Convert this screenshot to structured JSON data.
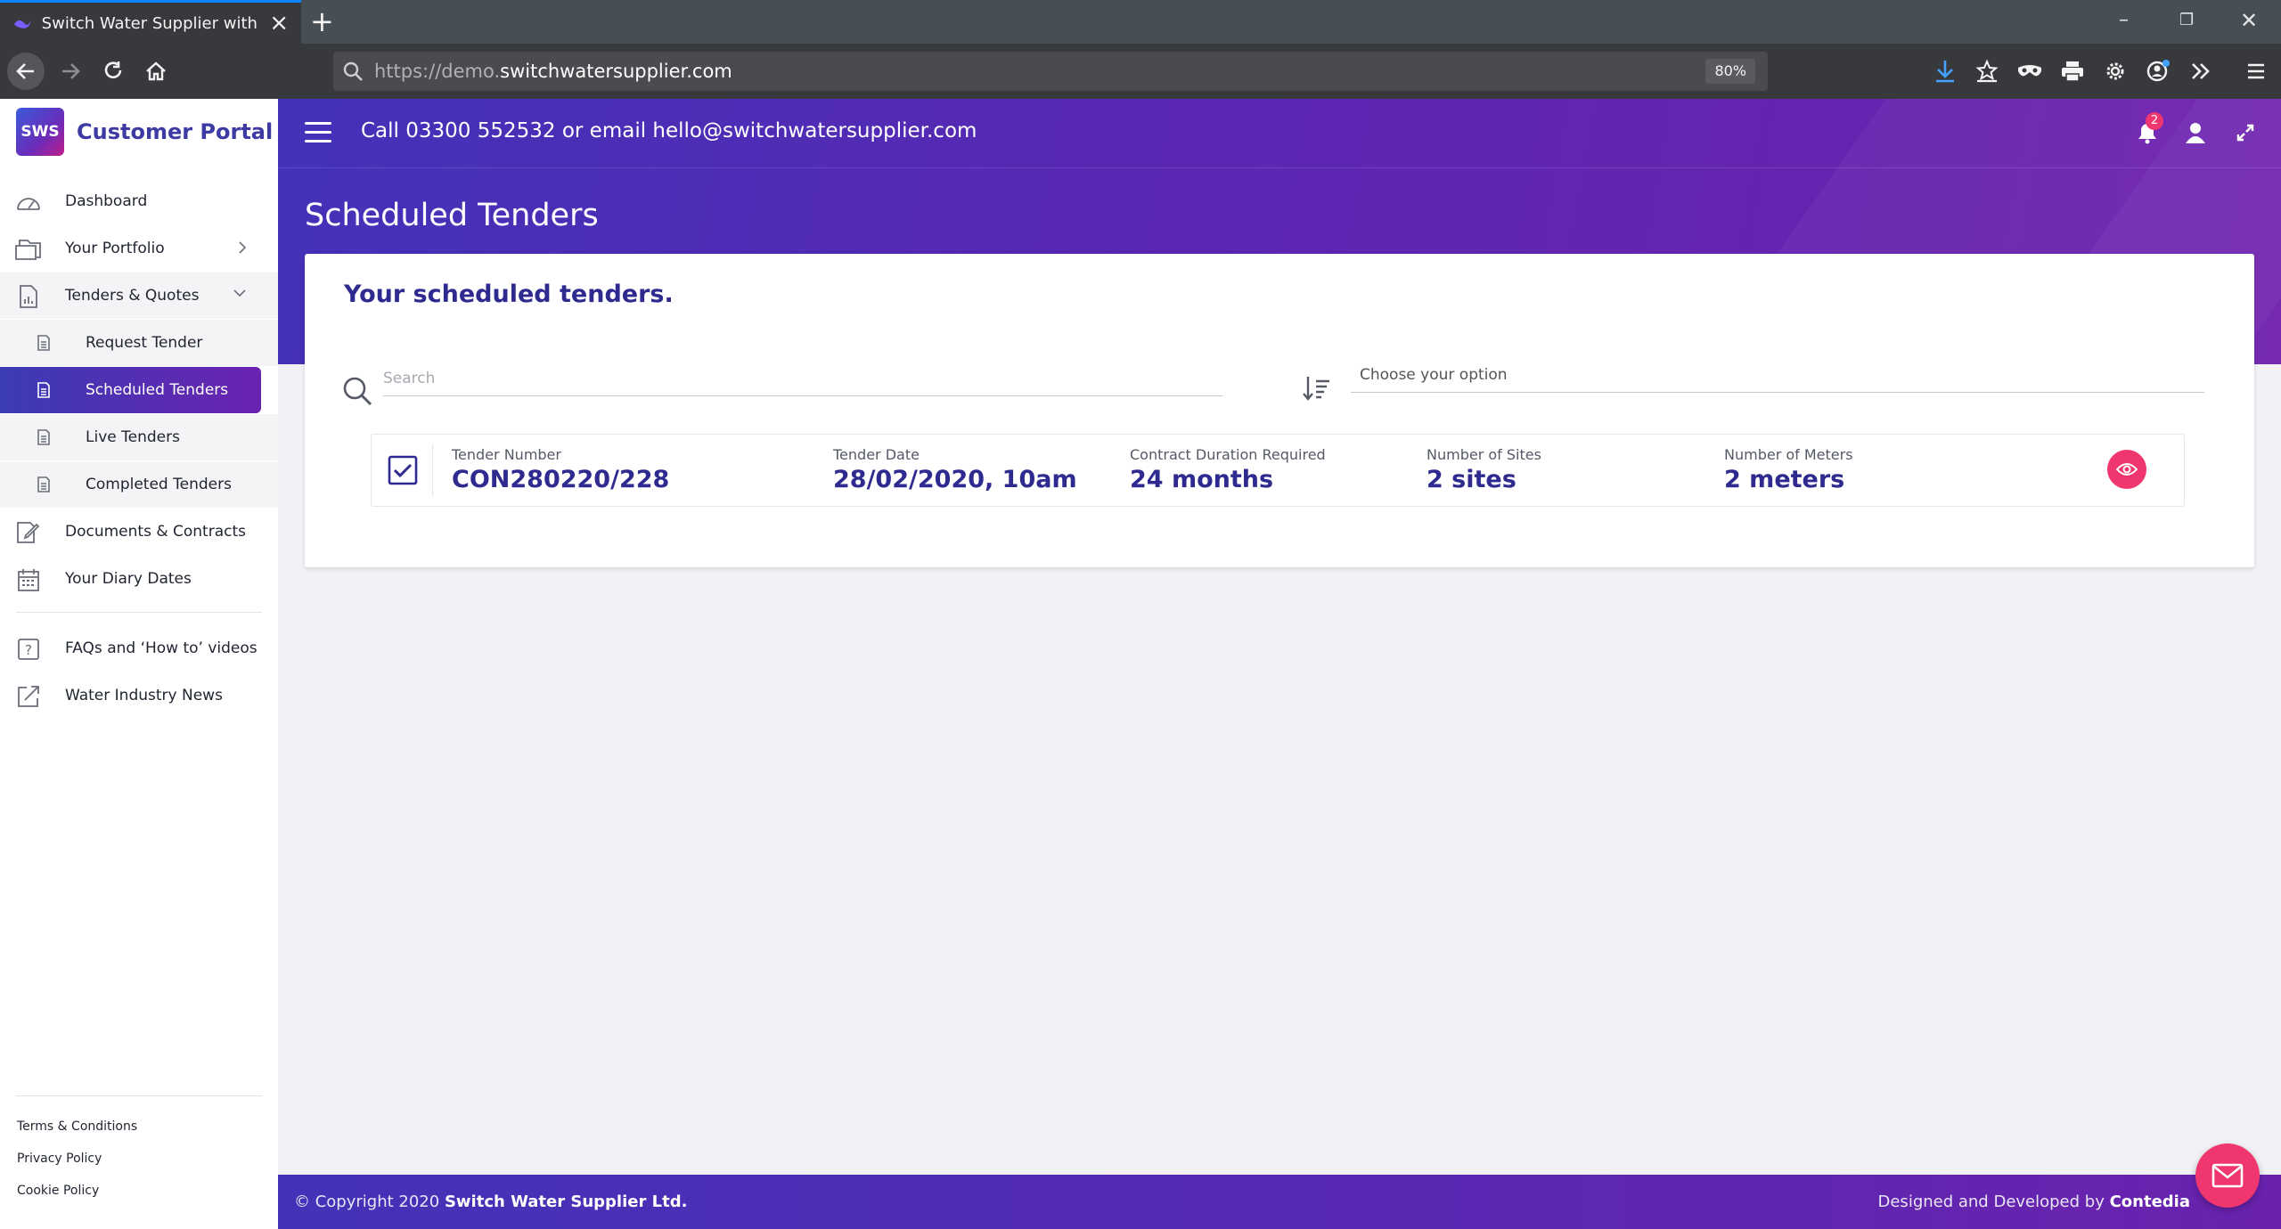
{
  "browser": {
    "tab_title": "Switch Water Supplier with Swi",
    "url_prefix": "https://demo.",
    "url_domain": "switchwatersupplier.com",
    "zoom": "80%"
  },
  "sidebar": {
    "brand_logo": "SWS",
    "brand_name": "Customer Portal",
    "items": [
      {
        "label": "Dashboard",
        "icon": "gauge-icon"
      },
      {
        "label": "Your Portfolio",
        "icon": "folder-icon"
      },
      {
        "label": "Tenders & Quotes",
        "icon": "document-chart-icon"
      },
      {
        "label": "Documents & Contracts",
        "icon": "document-edit-icon"
      },
      {
        "label": "Your Diary Dates",
        "icon": "calendar-icon"
      },
      {
        "label": "FAQs and ‘How to’ videos",
        "icon": "help-icon"
      },
      {
        "label": "Water Industry News",
        "icon": "external-link-icon"
      }
    ],
    "sub_items": [
      {
        "label": "Request Tender"
      },
      {
        "label": "Scheduled Tenders"
      },
      {
        "label": "Live Tenders"
      },
      {
        "label": "Completed Tenders"
      }
    ],
    "footer_links": [
      "Terms & Conditions",
      "Privacy Policy",
      "Cookie Policy"
    ]
  },
  "header": {
    "contact": "Call 03300 552532 or email hello@switchwatersupplier.com",
    "notification_count": "2"
  },
  "page": {
    "title": "Scheduled Tenders",
    "card_title": "Your scheduled tenders.",
    "search_placeholder": "Search",
    "sort_placeholder": "Choose your option"
  },
  "tender": {
    "number_label": "Tender Number",
    "number": "CON280220/228",
    "date_label": "Tender Date",
    "date": "28/02/2020, 10am",
    "duration_label": "Contract Duration Required",
    "duration": "24 months",
    "sites_label": "Number of Sites",
    "sites": "2 sites",
    "meters_label": "Number of Meters",
    "meters": "2 meters"
  },
  "footer": {
    "copyright": "© Copyright 2020",
    "company": "Switch Water Supplier Ltd.",
    "designed": "Designed and Developed by",
    "developer": "Contedia"
  },
  "colors": {
    "brand_purple": "#4332b8",
    "accent_pink": "#f0366e",
    "heading_navy": "#2e2a8f"
  }
}
